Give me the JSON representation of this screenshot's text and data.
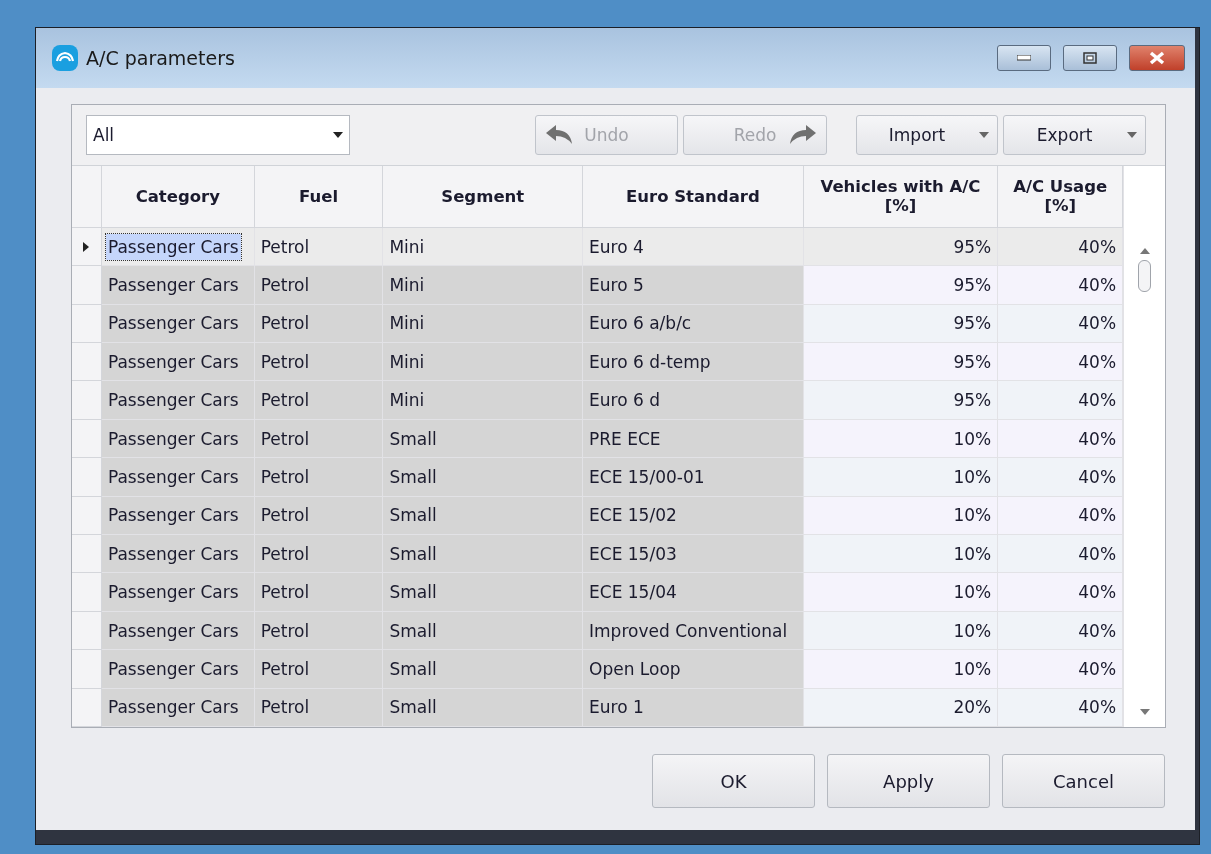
{
  "window": {
    "title": "A/C parameters"
  },
  "filter": {
    "value": "All"
  },
  "toolbar": [
    {
      "label": "Undo",
      "kind": "undo",
      "disabled": true
    },
    {
      "label": "Redo",
      "kind": "redo",
      "disabled": true
    },
    {
      "label": "Import",
      "kind": "menu",
      "disabled": false
    },
    {
      "label": "Export",
      "kind": "menu",
      "disabled": false
    }
  ],
  "table": {
    "columns": [
      "Category",
      "Fuel",
      "Segment",
      "Euro Standard",
      "Vehicles with A/C\n[%]",
      "A/C Usage\n[%]"
    ],
    "rows": [
      {
        "selected": true,
        "cells": [
          "Passenger Cars",
          "Petrol",
          "Mini",
          "Euro 4",
          "95%",
          "40%"
        ]
      },
      {
        "selected": false,
        "cells": [
          "Passenger Cars",
          "Petrol",
          "Mini",
          "Euro 5",
          "95%",
          "40%"
        ]
      },
      {
        "selected": false,
        "cells": [
          "Passenger Cars",
          "Petrol",
          "Mini",
          "Euro 6 a/b/c",
          "95%",
          "40%"
        ]
      },
      {
        "selected": false,
        "cells": [
          "Passenger Cars",
          "Petrol",
          "Mini",
          "Euro 6 d-temp",
          "95%",
          "40%"
        ]
      },
      {
        "selected": false,
        "cells": [
          "Passenger Cars",
          "Petrol",
          "Mini",
          "Euro 6 d",
          "95%",
          "40%"
        ]
      },
      {
        "selected": false,
        "cells": [
          "Passenger Cars",
          "Petrol",
          "Small",
          "PRE ECE",
          "10%",
          "40%"
        ]
      },
      {
        "selected": false,
        "cells": [
          "Passenger Cars",
          "Petrol",
          "Small",
          "ECE 15/00-01",
          "10%",
          "40%"
        ]
      },
      {
        "selected": false,
        "cells": [
          "Passenger Cars",
          "Petrol",
          "Small",
          "ECE 15/02",
          "10%",
          "40%"
        ]
      },
      {
        "selected": false,
        "cells": [
          "Passenger Cars",
          "Petrol",
          "Small",
          "ECE 15/03",
          "10%",
          "40%"
        ]
      },
      {
        "selected": false,
        "cells": [
          "Passenger Cars",
          "Petrol",
          "Small",
          "ECE 15/04",
          "10%",
          "40%"
        ]
      },
      {
        "selected": false,
        "cells": [
          "Passenger Cars",
          "Petrol",
          "Small",
          "Improved Conventional",
          "10%",
          "40%"
        ]
      },
      {
        "selected": false,
        "cells": [
          "Passenger Cars",
          "Petrol",
          "Small",
          "Open Loop",
          "10%",
          "40%"
        ]
      },
      {
        "selected": false,
        "cells": [
          "Passenger Cars",
          "Petrol",
          "Small",
          "Euro 1",
          "20%",
          "40%"
        ]
      }
    ]
  },
  "buttons": [
    "OK",
    "Apply",
    "Cancel"
  ]
}
